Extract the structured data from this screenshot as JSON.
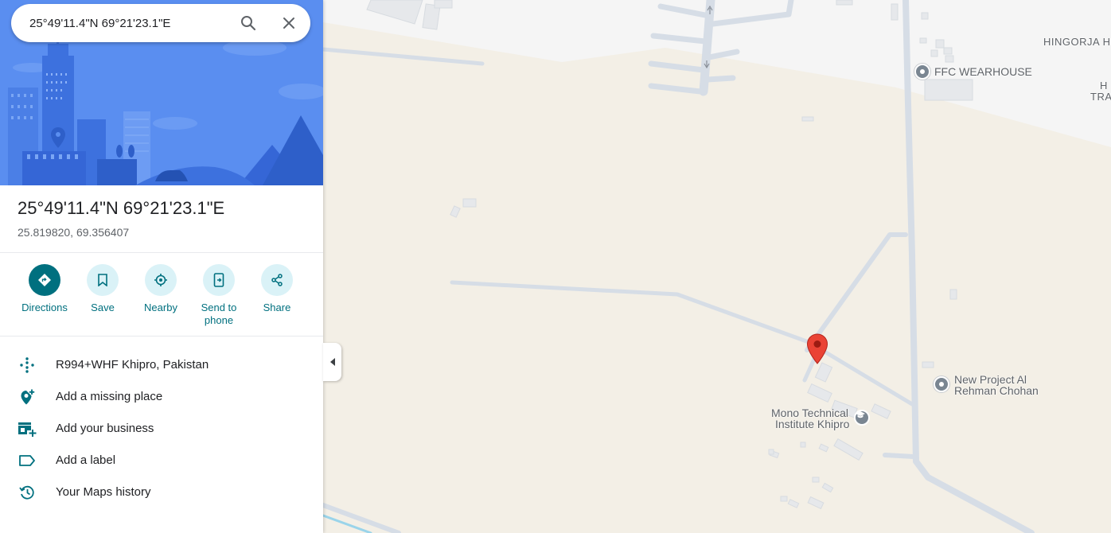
{
  "search": {
    "value": "25°49'11.4\"N 69°21'23.1\"E",
    "search_label": "Search",
    "close_label": "Close"
  },
  "place": {
    "title": "25°49'11.4\"N 69°21'23.1\"E",
    "coords": "25.819820, 69.356407"
  },
  "actions": [
    {
      "label": "Directions",
      "icon": "directions-icon"
    },
    {
      "label": "Save",
      "icon": "bookmark-icon"
    },
    {
      "label": "Nearby",
      "icon": "nearby-icon"
    },
    {
      "label": "Send to phone",
      "icon": "send-to-phone-icon"
    },
    {
      "label": "Share",
      "icon": "share-icon"
    }
  ],
  "details": [
    {
      "text": "R994+WHF Khipro, Pakistan",
      "icon": "plus-code-icon"
    },
    {
      "text": "Add a missing place",
      "icon": "add-place-icon"
    },
    {
      "text": "Add your business",
      "icon": "add-business-icon"
    },
    {
      "text": "Add a label",
      "icon": "label-icon"
    },
    {
      "text": "Your Maps history",
      "icon": "history-icon"
    }
  ],
  "map": {
    "labels": {
      "hingorja": "HINGORJA HO",
      "ffc": "FFC WEARHOUSE",
      "h": "H",
      "tra": "TRA",
      "new_project_1": "New Project Al",
      "new_project_2": "Rehman Chohan",
      "mono_1": "Mono Technical",
      "mono_2": "Institute Khipro"
    },
    "pin_color": "#ea4335"
  },
  "colors": {
    "accent": "#00707f",
    "accent_light": "#daf2f7",
    "hero_blue": "#5a8ef0"
  }
}
